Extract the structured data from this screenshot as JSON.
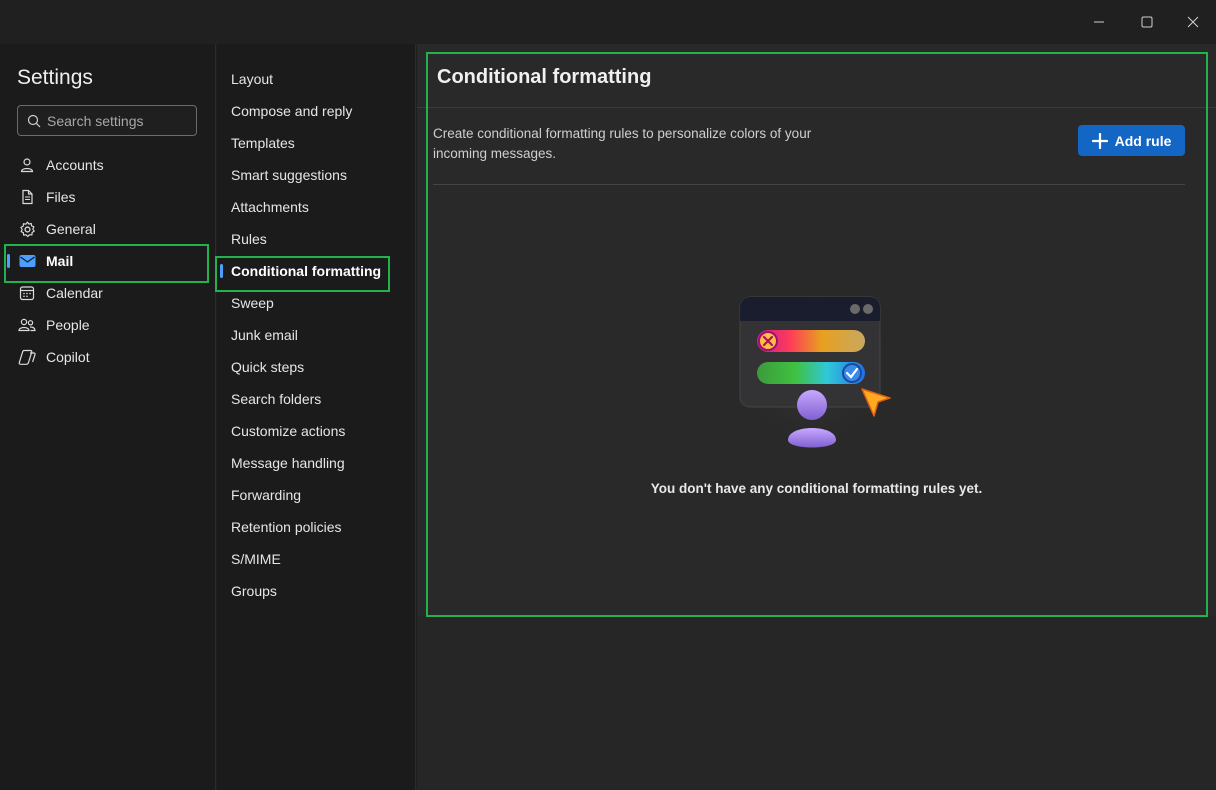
{
  "window": {
    "minimize_icon": "minimize-icon",
    "maximize_icon": "maximize-icon",
    "close_icon": "close-icon"
  },
  "sidebar": {
    "title": "Settings",
    "search_placeholder": "Search settings",
    "items": [
      {
        "label": "Accounts",
        "icon": "person-icon"
      },
      {
        "label": "Files",
        "icon": "document-icon"
      },
      {
        "label": "General",
        "icon": "gear-icon"
      },
      {
        "label": "Mail",
        "icon": "mail-icon",
        "selected": true
      },
      {
        "label": "Calendar",
        "icon": "calendar-icon"
      },
      {
        "label": "People",
        "icon": "people-icon"
      },
      {
        "label": "Copilot",
        "icon": "copilot-icon"
      }
    ]
  },
  "mail_nav": {
    "items": [
      "Layout",
      "Compose and reply",
      "Templates",
      "Smart suggestions",
      "Attachments",
      "Rules",
      "Conditional formatting",
      "Sweep",
      "Junk email",
      "Quick steps",
      "Search folders",
      "Customize actions",
      "Message handling",
      "Forwarding",
      "Retention policies",
      "S/MIME",
      "Groups"
    ],
    "selected_index": 6
  },
  "panel": {
    "title": "Conditional formatting",
    "description": "Create conditional formatting rules to personalize colors of your incoming messages.",
    "add_rule_label": "Add rule",
    "empty_message": "You don't have any conditional formatting rules yet."
  },
  "colors": {
    "accent": "#4a9fff",
    "button": "#1466c4",
    "highlight": "#22b14c"
  }
}
